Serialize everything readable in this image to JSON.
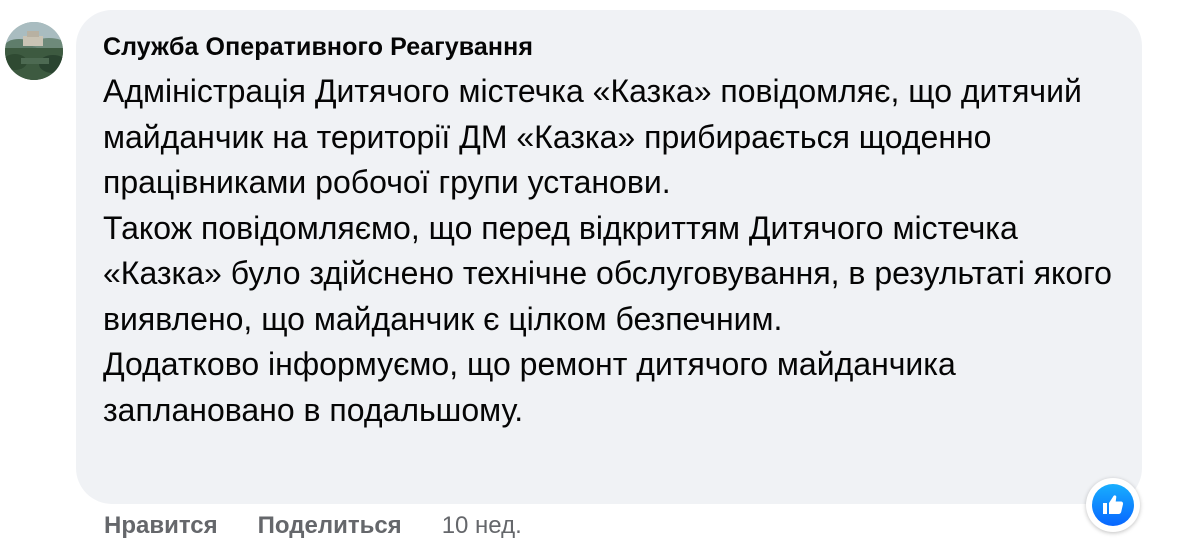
{
  "comment": {
    "author": "Служба Оперативного Реагування",
    "paragraphs": [
      "Адміністрація Дитячого містечка «Казка» повідомляє, що дитячий майданчик на території ДМ «Казка» прибирається щоденно працівниками робочої групи установи.",
      "Також повідомляємо, що перед відкриттям Дитячого містечка «Казка» було здійснено технічне обслуговування, в результаті якого виявлено, що майданчик є цілком безпечним.",
      "Додатково інформуємо, що ремонт дитячого майданчика заплановано в подальшому."
    ]
  },
  "actions": {
    "like_label": "Нравится",
    "share_label": "Поделиться",
    "time": "10 нед."
  },
  "reaction": {
    "icon": "thumbs-up-icon",
    "color": "#0866ff"
  },
  "colors": {
    "bubble": "#f0f2f5",
    "text": "#050505",
    "secondary": "#65676b"
  }
}
